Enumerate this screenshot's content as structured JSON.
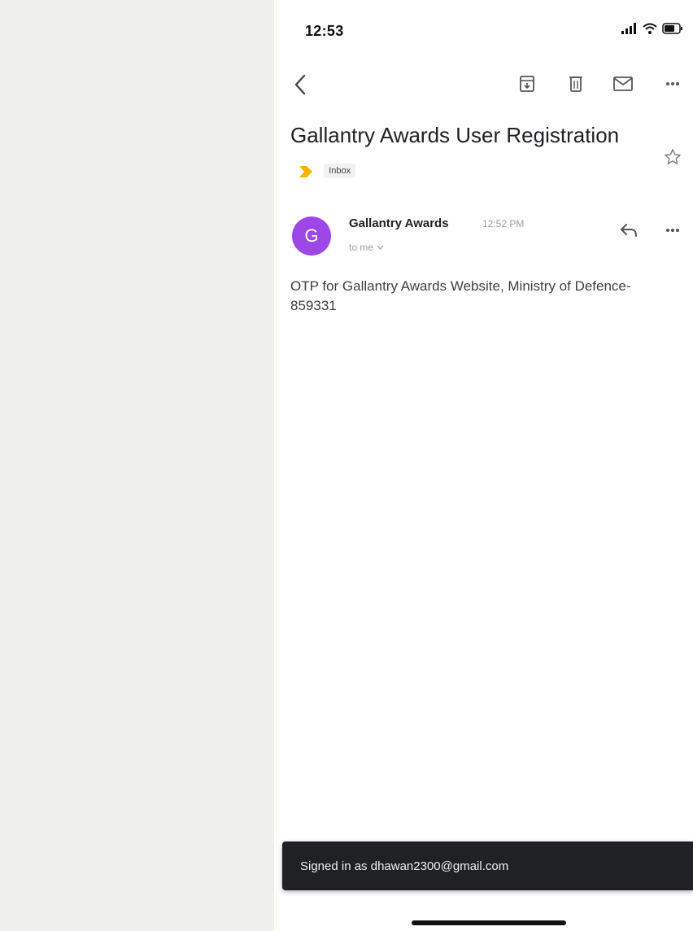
{
  "status_bar": {
    "time": "12:53"
  },
  "toolbar": {
    "back": "back-icon",
    "archive": "archive-icon",
    "delete": "trash-icon",
    "mark_unread": "mail-icon",
    "more": "more-horizontal-icon"
  },
  "email": {
    "subject": "Gallantry Awards User Registration",
    "label": "Inbox",
    "sender": {
      "name": "Gallantry Awards",
      "initial": "G",
      "time": "12:52 PM",
      "recipient": "to me",
      "avatar_color": "#9c47e6"
    },
    "body": "OTP for Gallantry Awards Website, Ministry of Defence-859331"
  },
  "snackbar": {
    "text": "Signed in as dhawan2300@gmail.com"
  },
  "colors": {
    "important_marker": "#f4b400",
    "snackbar_bg": "#202124"
  }
}
